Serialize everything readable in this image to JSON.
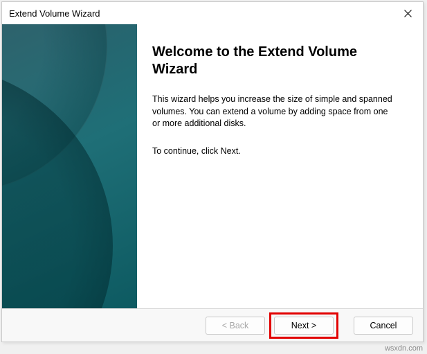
{
  "window": {
    "title": "Extend Volume Wizard"
  },
  "content": {
    "heading": "Welcome to the Extend Volume Wizard",
    "body": "This wizard helps you increase the size of simple and spanned volumes. You can extend a volume  by adding space from one or more additional disks.",
    "continue": "To continue, click Next."
  },
  "buttons": {
    "back": "< Back",
    "next": "Next >",
    "cancel": "Cancel"
  },
  "watermark": "wsxdn.com"
}
